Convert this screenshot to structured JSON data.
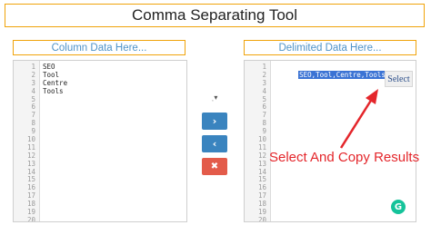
{
  "header": {
    "title": "Comma Separating Tool"
  },
  "left_panel": {
    "label": "Column Data Here...",
    "line_numbers": [
      "1",
      "2",
      "3",
      "4",
      "5",
      "6",
      "7",
      "8",
      "9",
      "10",
      "11",
      "12",
      "13",
      "14",
      "15",
      "16",
      "17",
      "18",
      "19",
      "20"
    ],
    "lines": [
      "SEO",
      "Tool",
      "Centre",
      "Tools"
    ]
  },
  "right_panel": {
    "label": "Delimited Data Here...",
    "line_numbers": [
      "1",
      "2",
      "3",
      "4",
      "5",
      "6",
      "7",
      "8",
      "9",
      "10",
      "11",
      "12",
      "13",
      "14",
      "15",
      "16",
      "17",
      "18",
      "19",
      "20"
    ],
    "selected_text": "SEO,Tool,Centre,Tools",
    "select_button": "Select"
  },
  "controls": {
    "delimiter_glyph": "ˌ▾",
    "convert_right": "›",
    "convert_left": "‹",
    "clear": "✖"
  },
  "annotation": {
    "text": "Select And Copy Results",
    "color": "#e4262b"
  },
  "grammarly_badge": "G",
  "colors": {
    "accent_border": "#f0a30a",
    "label_blue": "#4f93c9",
    "button_blue": "#3a84bf",
    "button_red": "#e35b4a",
    "selection": "#3b73d4"
  }
}
